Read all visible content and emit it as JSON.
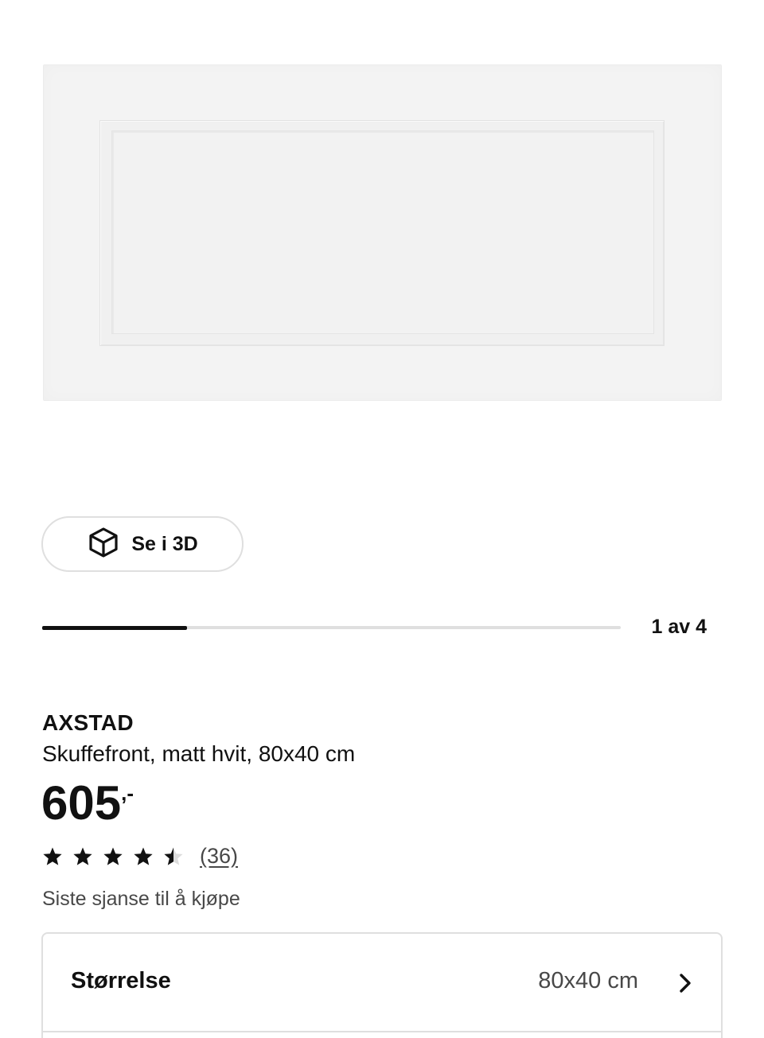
{
  "gallery": {
    "view_3d_label": "Se i 3D",
    "counter": "1 av 4",
    "current_image": 1,
    "total_images": 4
  },
  "product": {
    "name": "AXSTAD",
    "description": "Skuffefront, matt hvit, 80x40 cm",
    "price": "605",
    "price_suffix": ",-",
    "rating": 4.5,
    "rating_max": 5,
    "review_count": "(36)",
    "availability": "Siste sjanse til å kjøpe"
  },
  "size_selector": {
    "label": "Størrelse",
    "value": "80x40 cm"
  },
  "icons": {
    "view_3d": "cube-icon",
    "star_full": "star-icon",
    "star_half": "star-half-icon",
    "chevron": "chevron-right-icon"
  },
  "colors": {
    "text": "#111111",
    "muted": "#484848",
    "border": "#dfdfdf"
  }
}
